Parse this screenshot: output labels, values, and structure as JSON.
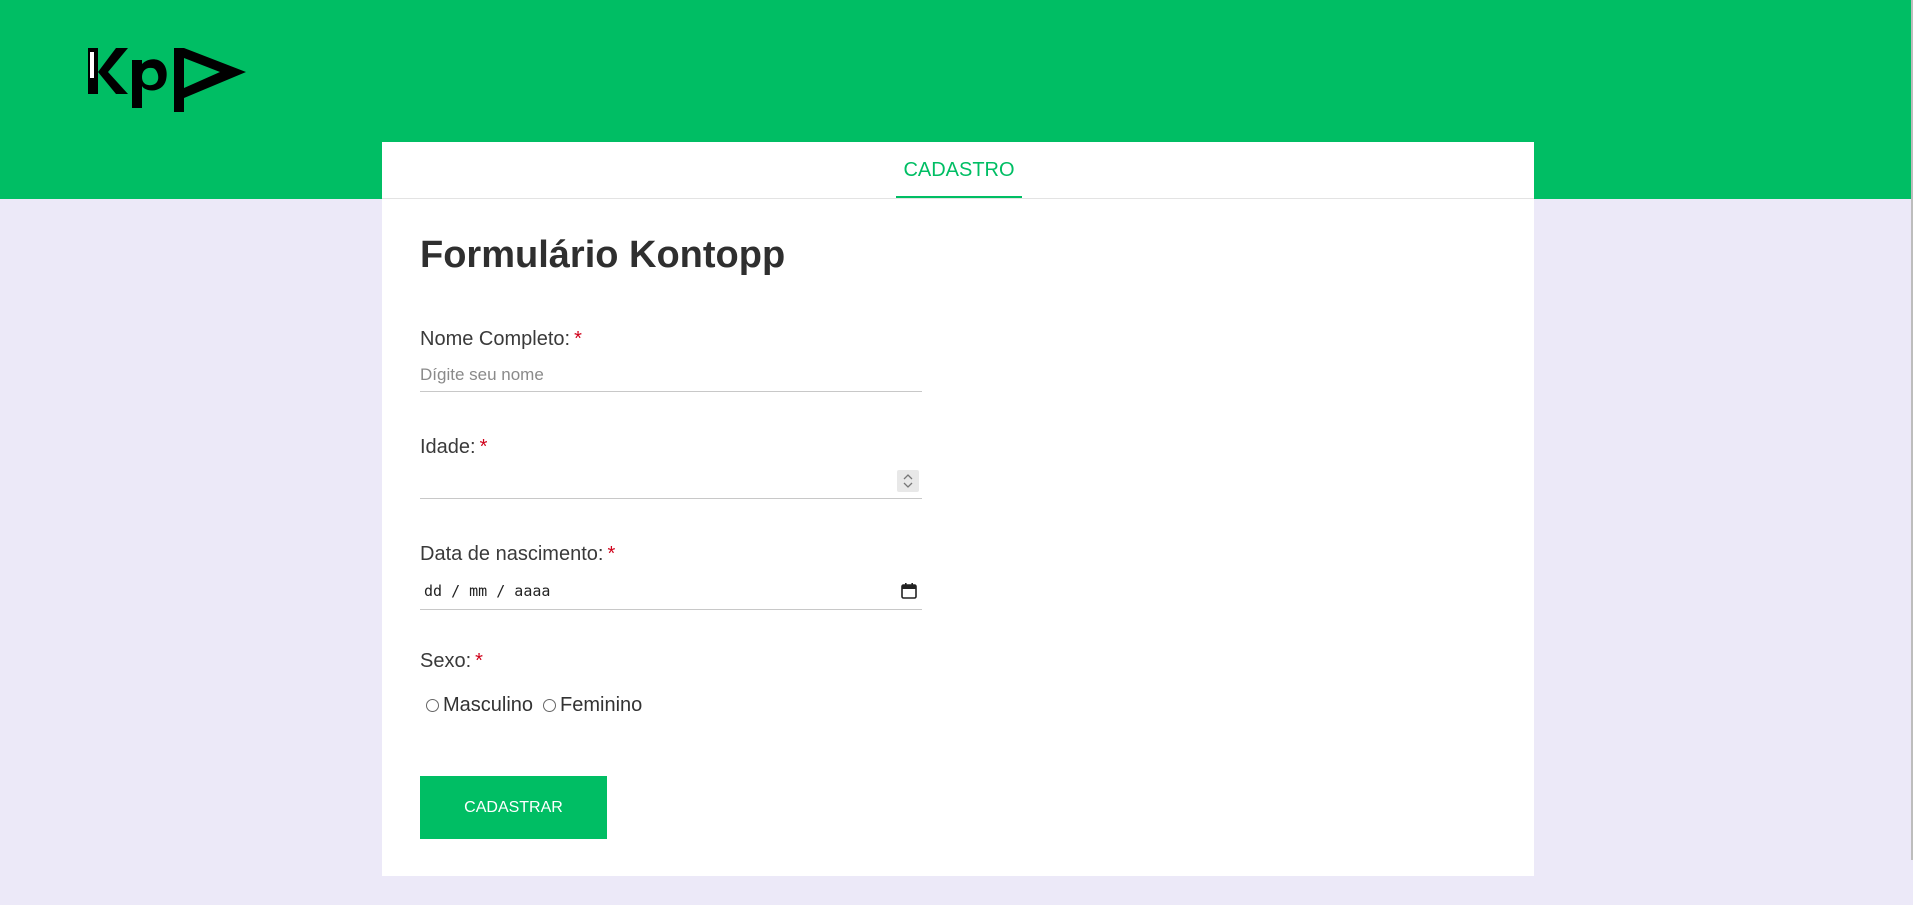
{
  "header": {
    "logo_alt": "Kp",
    "brand_color": "#00be64"
  },
  "tabs": [
    {
      "label": "CADASTRO",
      "active": true
    }
  ],
  "form": {
    "title": "Formulário Kontopp",
    "name_field": {
      "label": "Nome Completo:",
      "required_mark": "*",
      "placeholder": "Dígite seu nome",
      "value": ""
    },
    "age_field": {
      "label": "Idade:",
      "required_mark": "*",
      "value": ""
    },
    "birth_field": {
      "label": "Data de nascimento:",
      "required_mark": "*",
      "placeholder": "dd / mm / aaaa"
    },
    "sex_field": {
      "label": "Sexo:",
      "required_mark": "*",
      "options": [
        "Masculino",
        "Feminino"
      ]
    },
    "submit_label": "CADASTRAR"
  },
  "icons": {
    "calendar": "calendar-icon",
    "spinner": "number-spinner-icon"
  }
}
